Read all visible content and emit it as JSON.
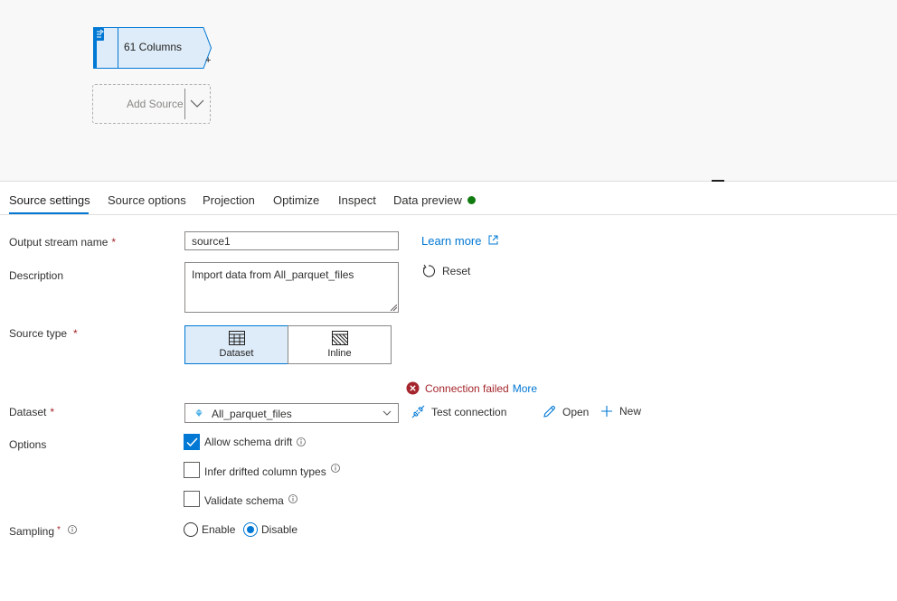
{
  "canvas": {
    "node_label": "61 Columns",
    "node_plus": "+",
    "add_source_label": "Add Source"
  },
  "tabs": [
    {
      "label": "Source settings",
      "active": true
    },
    {
      "label": "Source options"
    },
    {
      "label": "Projection"
    },
    {
      "label": "Optimize"
    },
    {
      "label": "Inspect"
    },
    {
      "label": "Data preview"
    }
  ],
  "form": {
    "output_stream": {
      "label": "Output stream name",
      "required": "*",
      "value": "source1"
    },
    "learn_more": "Learn more",
    "description": {
      "label": "Description",
      "value": "Import data from All_parquet_files"
    },
    "reset": "Reset",
    "source_type": {
      "label": "Source type",
      "required": "*",
      "options": [
        {
          "label": "Dataset",
          "selected": true,
          "icon": "table-icon"
        },
        {
          "label": "Inline",
          "selected": false,
          "icon": "hatched-table-icon"
        }
      ]
    },
    "connection_error": {
      "text": "Connection failed",
      "more": "More"
    },
    "dataset": {
      "label": "Dataset",
      "required": "*",
      "value": "All_parquet_files"
    },
    "test_connection": "Test connection",
    "open": "Open",
    "new": "New",
    "options": {
      "label": "Options",
      "items": [
        {
          "label": "Allow schema drift",
          "checked": true
        },
        {
          "label": "Infer drifted column types",
          "checked": false
        },
        {
          "label": "Validate schema",
          "checked": false
        }
      ]
    },
    "sampling": {
      "label": "Sampling",
      "required": "*",
      "options": [
        {
          "label": "Enable",
          "checked": false
        },
        {
          "label": "Disable",
          "checked": true
        }
      ]
    }
  },
  "colors": {
    "accent": "#0078d4",
    "error": "#a4262c",
    "success": "#107c10",
    "node_fill": "#deecf9"
  }
}
